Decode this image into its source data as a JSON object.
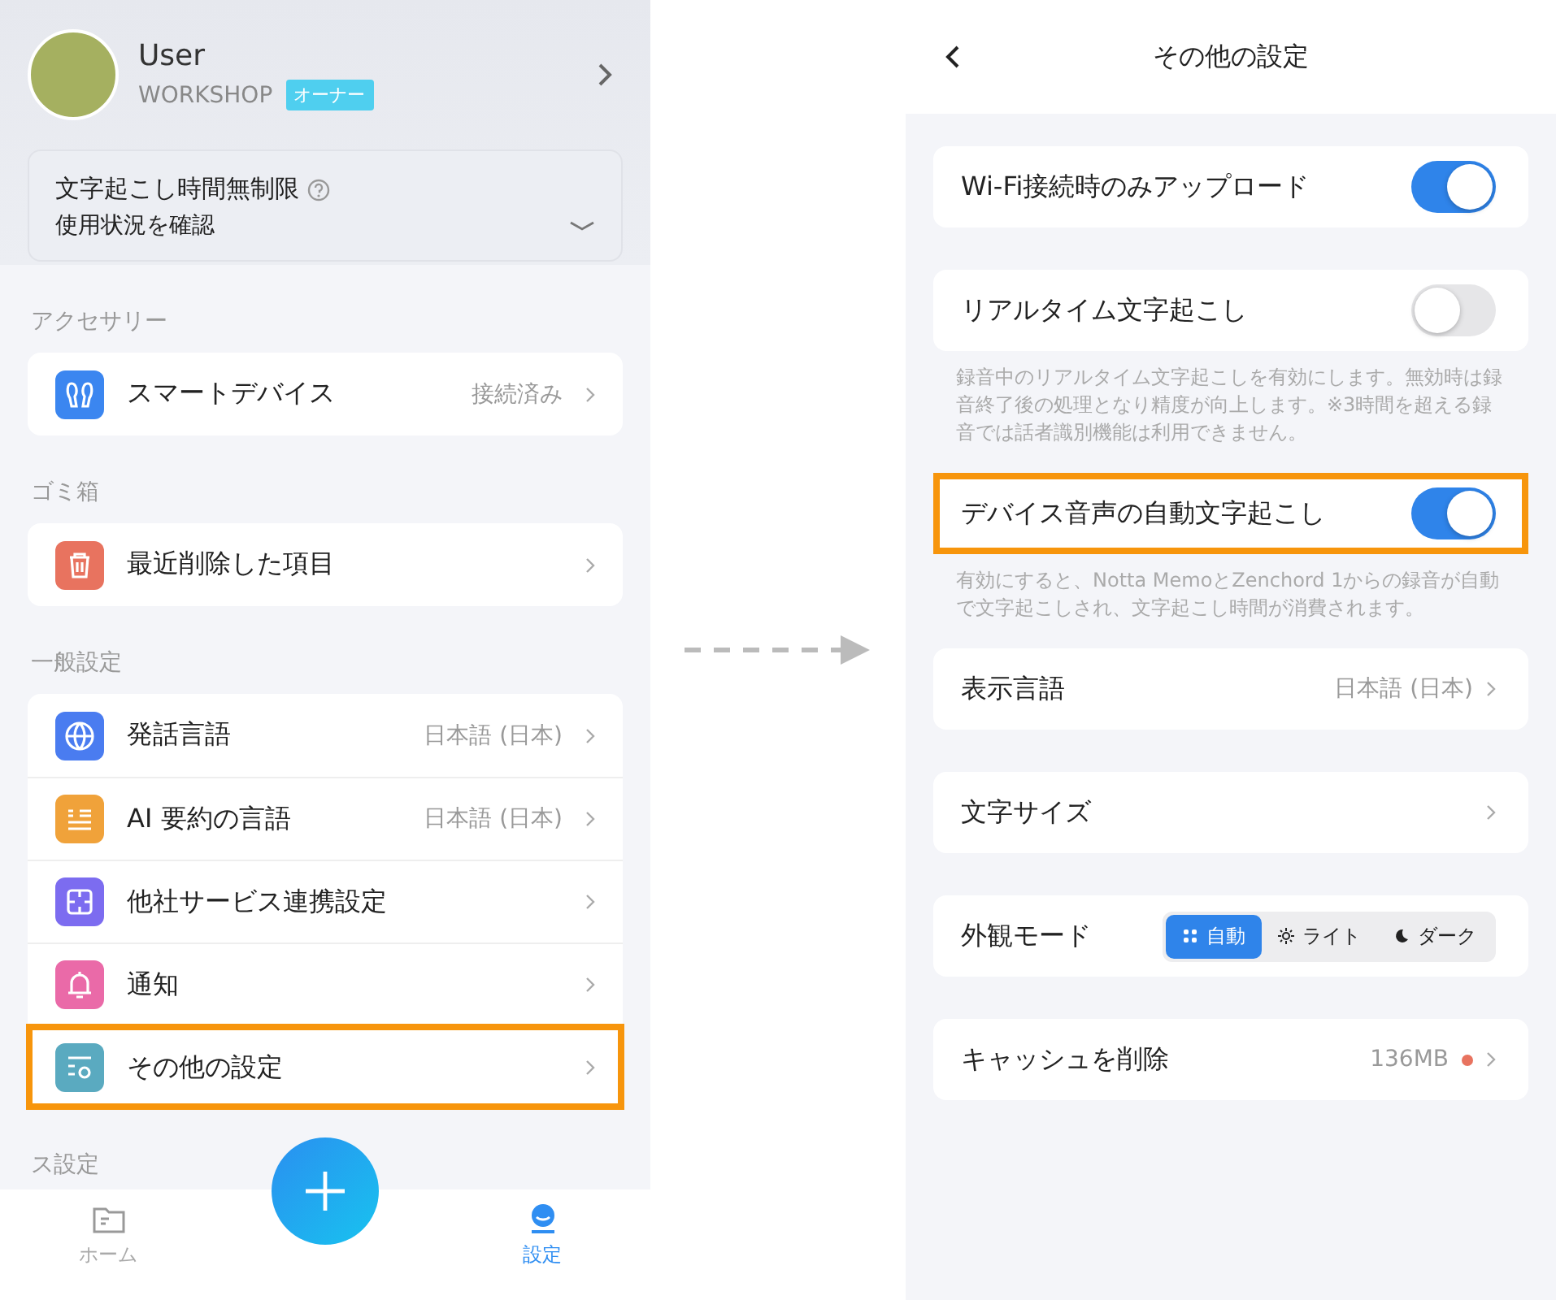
{
  "left": {
    "profile": {
      "name": "User",
      "org": "WORKSHOP",
      "role": "オーナー"
    },
    "usage": {
      "title": "文字起こし時間無制限",
      "subtitle": "使用状況を確認"
    },
    "sections": [
      {
        "title": "アクセサリー",
        "items": [
          {
            "label": "スマートデバイス",
            "value": "接続済み",
            "color": "#3b86f0",
            "highlighted": false
          }
        ]
      },
      {
        "title": "ゴミ箱",
        "items": [
          {
            "label": "最近削除した項目",
            "color": "#e8735f",
            "highlighted": false
          }
        ]
      },
      {
        "title": "一般設定",
        "items": [
          {
            "label": "発話言語",
            "value": "日本語 (日本)",
            "color": "#4a7cf0",
            "highlighted": false
          },
          {
            "label": "AI 要約の言語",
            "value": "日本語 (日本)",
            "color": "#f0a23a",
            "highlighted": false
          },
          {
            "label": "他社サービス連携設定",
            "color": "#7c6cf0",
            "highlighted": false
          },
          {
            "label": "通知",
            "color": "#ea6aa8",
            "highlighted": false
          },
          {
            "label": "その他の設定",
            "color": "#5aaac0",
            "highlighted": true
          }
        ]
      },
      {
        "title": "ス設定"
      }
    ],
    "nav": [
      {
        "label": "ホーム",
        "selected": false
      },
      {
        "label": "設定",
        "selected": true
      }
    ]
  },
  "right": {
    "title": "その他の設定",
    "rows": [
      {
        "kind": "toggle",
        "label": "Wi-Fi接続時のみアップロード",
        "on": true,
        "highlighted": false
      },
      {
        "kind": "toggle",
        "label": "リアルタイム文字起こし",
        "on": false,
        "highlighted": false,
        "note": "録音中のリアルタイム文字起こしを有効にします。無効時は録音終了後の処理となり精度が向上します。※3時間を超える録音では話者識別機能は利用できません。"
      },
      {
        "kind": "toggle",
        "label": "デバイス音声の自動文字起こし",
        "on": true,
        "highlighted": true,
        "note": "有効にすると、Notta MemoとZenchord 1からの録音が自動で文字起こしされ、文字起こし時間が消費されます。"
      },
      {
        "kind": "link",
        "label": "表示言語",
        "value": "日本語 (日本)",
        "highlighted": false
      },
      {
        "kind": "link",
        "label": "文字サイズ",
        "highlighted": false
      },
      {
        "kind": "segment",
        "label": "外観モード",
        "highlighted": false,
        "options": [
          {
            "label": "自動",
            "selected": true
          },
          {
            "label": "ライト",
            "selected": false
          },
          {
            "label": "ダーク",
            "selected": false
          }
        ]
      },
      {
        "kind": "link",
        "label": "キャッシュを削除",
        "value": "136MB",
        "dot": true,
        "highlighted": false
      }
    ]
  }
}
